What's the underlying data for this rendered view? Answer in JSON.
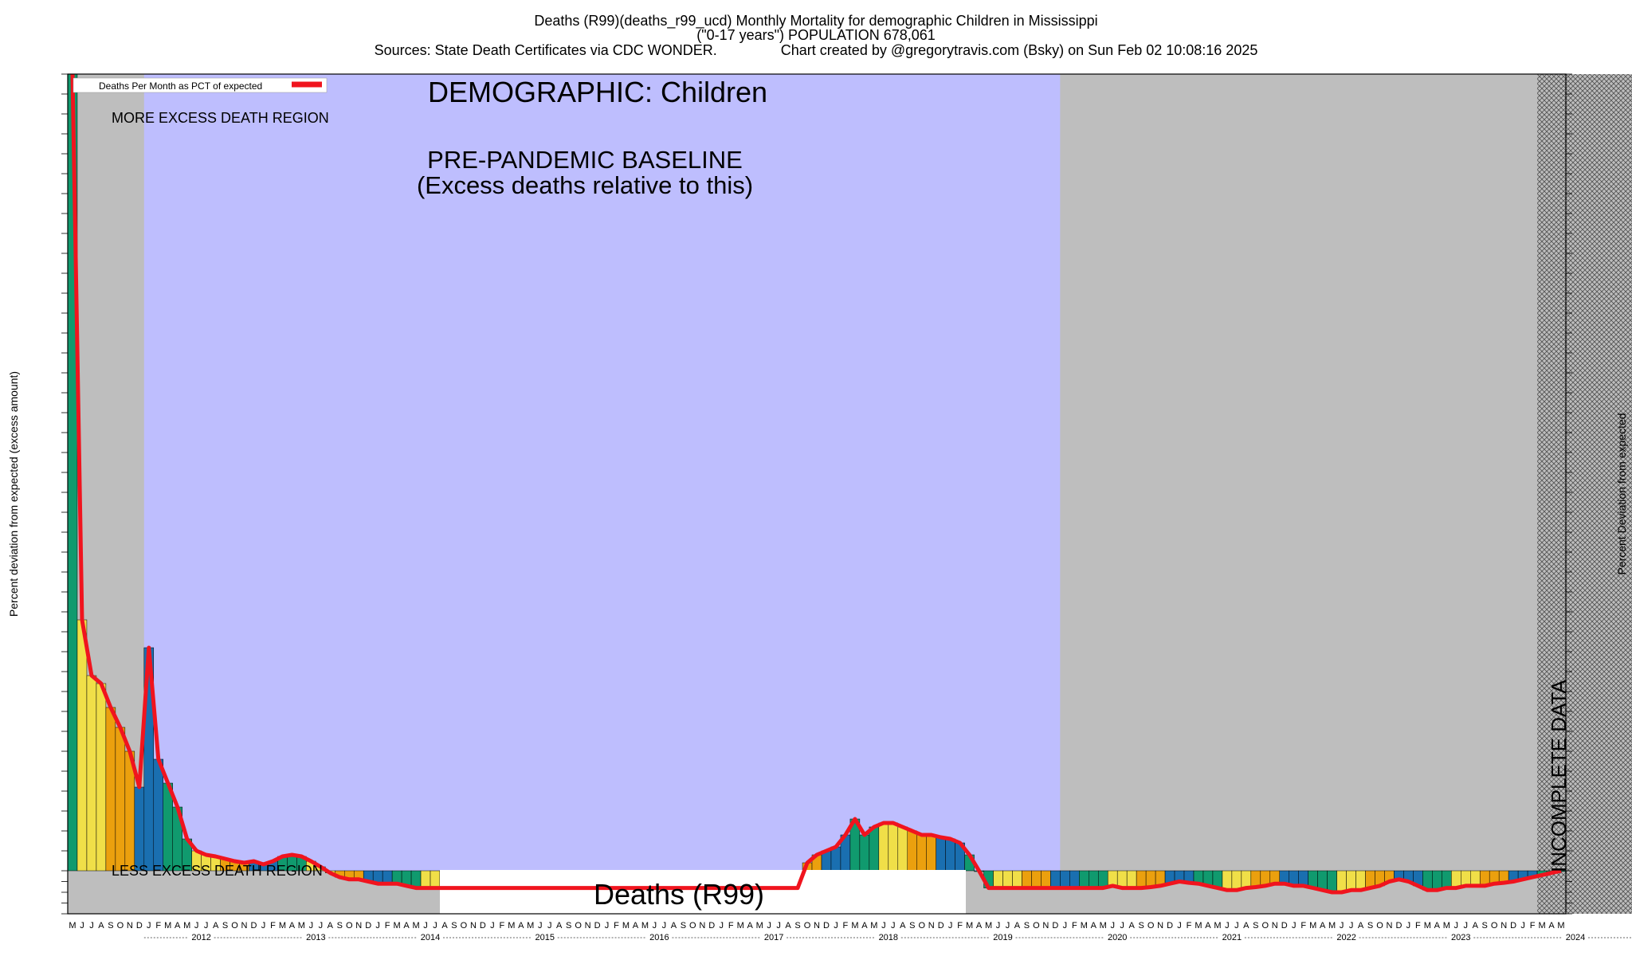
{
  "header": {
    "title_line1": "Deaths (R99)(deaths_r99_ucd) Monthly Mortality for demographic Children in Mississippi",
    "title_line2": "(\"0-17 years\") POPULATION 678,061",
    "title_line3": "Sources: State Death Certificates via CDC WONDER.                Chart created by @gregorytravis.com (Bsky) on Sun Feb 02 10:08:16 2025"
  },
  "annotations": {
    "demographic": "DEMOGRAPHIC: Children",
    "more_excess": "MORE EXCESS DEATH REGION",
    "less_excess": "LESS EXCESS DEATH REGION",
    "baseline_1": "PRE-PANDEMIC BASELINE",
    "baseline_2": "(Excess deaths relative to this)",
    "cause_label": "Deaths (R99)",
    "incomplete": "INCOMPLETE DATA",
    "legend_label": "Deaths Per Month as PCT of expected"
  },
  "chart_data": {
    "type": "bar",
    "title": "Deaths (R99)(deaths_r99_ucd) Monthly Mortality for demographic Children in Mississippi",
    "ylabel_left": "Percent deviation from expected (excess amount)",
    "ylabel_right": "Percent Deviation from expected",
    "legend": [
      "Deaths Per Month as PCT of expected"
    ],
    "legend_placement": "top-left",
    "x_start": "2011-05",
    "x_end": "2024-12",
    "month_letters": [
      "J",
      "F",
      "M",
      "A",
      "M",
      "J",
      "J",
      "A",
      "S",
      "O",
      "N",
      "D"
    ],
    "year_labels": [
      "2012",
      "2013",
      "2014",
      "2015",
      "2016",
      "2017",
      "2018",
      "2019",
      "2020",
      "2021",
      "2022",
      "2023",
      "2024"
    ],
    "baseline_period": [
      "2012-01",
      "2019-12"
    ],
    "incomplete_period": [
      "2024-03",
      "2024-12"
    ],
    "ylim": [
      -100,
      1000
    ],
    "colors": {
      "teal": "#109a6e",
      "yellow": "#f0df48",
      "orange": "#eba00e",
      "blue": "#1a6fb0",
      "line": "#f0141e",
      "baseline_bg": "#bebefe",
      "grey_bg": "#bebebe"
    },
    "values": [
      1000,
      315,
      245,
      235,
      205,
      180,
      150,
      105,
      280,
      140,
      110,
      80,
      40,
      25,
      20,
      18,
      15,
      12,
      10,
      12,
      8,
      12,
      18,
      20,
      18,
      12,
      5,
      -5,
      -15,
      -20,
      -20,
      -25,
      -30,
      -30,
      -30,
      -35,
      -40,
      -40,
      -40,
      -40,
      -40,
      -40,
      -40,
      -40,
      -40,
      -40,
      -40,
      -40,
      -40,
      -40,
      -40,
      -40,
      -40,
      -40,
      -40,
      -40,
      -40,
      -40,
      -40,
      -40,
      -40,
      -40,
      -40,
      -40,
      -40,
      -40,
      -40,
      -40,
      -40,
      -40,
      -40,
      -40,
      -40,
      -40,
      -40,
      -40,
      -40,
      10,
      20,
      25,
      30,
      45,
      65,
      45,
      55,
      60,
      60,
      55,
      50,
      45,
      45,
      42,
      40,
      35,
      20,
      0,
      -40,
      -40,
      -40,
      -40,
      -40,
      -40,
      -40,
      -40,
      -40,
      -40,
      -40,
      -40,
      -40,
      -35,
      -40,
      -40,
      -40,
      -38,
      -35,
      -30,
      -25,
      -28,
      -30,
      -35,
      -40,
      -45,
      -45,
      -40,
      -38,
      -35,
      -30,
      -30,
      -35,
      -35,
      -40,
      -45,
      -50,
      -50,
      -45,
      -45,
      -40,
      -35,
      -25,
      -20,
      -25,
      -35,
      -45,
      -45,
      -40,
      -40,
      -35,
      -35,
      -35,
      -30,
      -28,
      -25,
      -20,
      -15,
      -10,
      -5,
      0
    ]
  }
}
